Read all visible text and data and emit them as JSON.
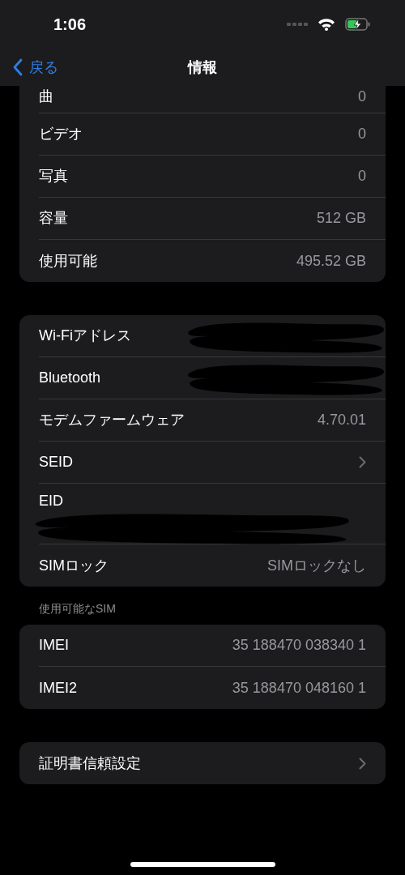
{
  "status_bar": {
    "time": "1:06"
  },
  "nav": {
    "back": "戻る",
    "title": "情報"
  },
  "groups": [
    {
      "rows": [
        {
          "kind": "value",
          "label": "曲",
          "value": "0"
        },
        {
          "kind": "value",
          "label": "ビデオ",
          "value": "0"
        },
        {
          "kind": "value",
          "label": "写真",
          "value": "0"
        },
        {
          "kind": "value",
          "label": "容量",
          "value": "512 GB"
        },
        {
          "kind": "value",
          "label": "使用可能",
          "value": "495.52 GB"
        }
      ]
    },
    {
      "rows": [
        {
          "kind": "redacted",
          "label": "Wi-Fiアドレス"
        },
        {
          "kind": "redacted",
          "label": "Bluetooth"
        },
        {
          "kind": "value",
          "label": "モデムファームウェア",
          "value": "4.70.01"
        },
        {
          "kind": "link",
          "label": "SEID"
        },
        {
          "kind": "redacted_below",
          "label": "EID"
        },
        {
          "kind": "value",
          "label": "SIMロック",
          "value": "SIMロックなし"
        }
      ]
    },
    {
      "header": "使用可能なSIM",
      "rows": [
        {
          "kind": "value",
          "label": "IMEI",
          "value": "35 188470 038340 1"
        },
        {
          "kind": "value",
          "label": "IMEI2",
          "value": "35 188470 048160 1"
        }
      ]
    },
    {
      "rows": [
        {
          "kind": "link",
          "label": "証明書信頼設定"
        }
      ]
    }
  ]
}
